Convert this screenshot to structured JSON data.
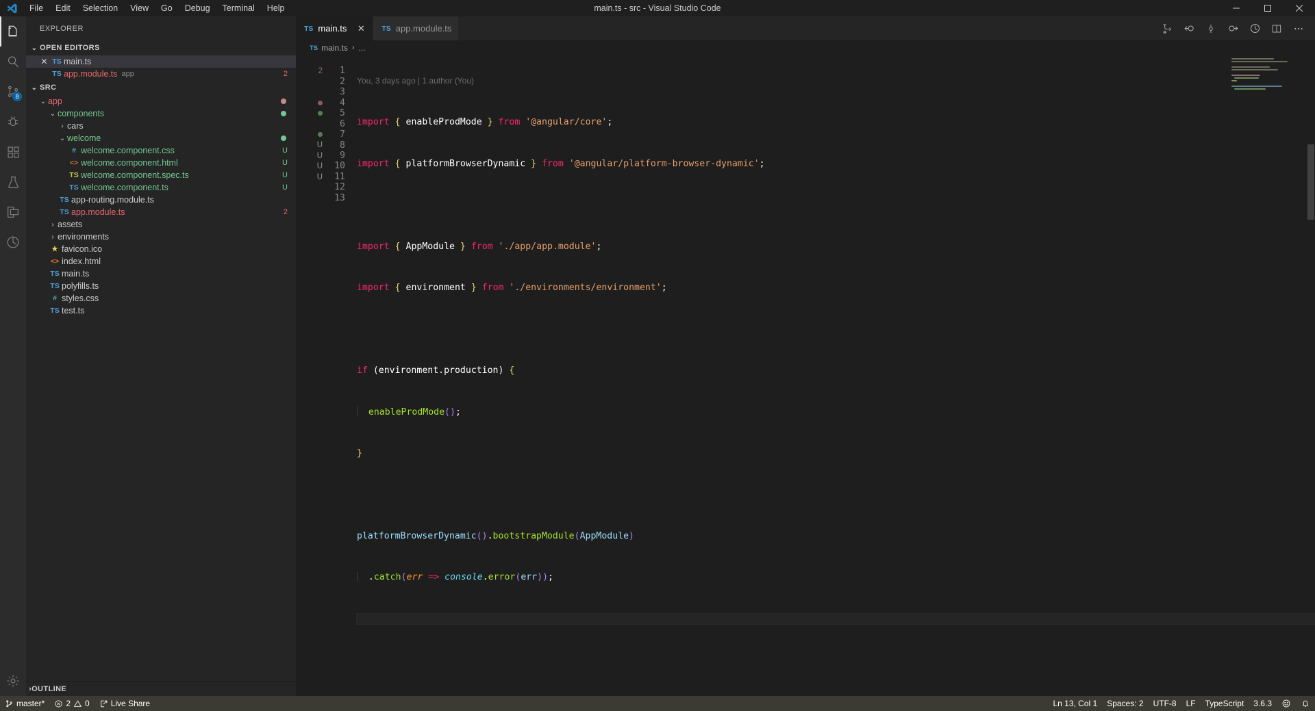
{
  "window": {
    "title": "main.ts - src - Visual Studio Code",
    "minimize_label": "─",
    "maximize_label": "□",
    "close_label": "✕"
  },
  "menubar": {
    "items": [
      {
        "label": "File"
      },
      {
        "label": "Edit"
      },
      {
        "label": "Selection"
      },
      {
        "label": "View"
      },
      {
        "label": "Go"
      },
      {
        "label": "Debug"
      },
      {
        "label": "Terminal"
      },
      {
        "label": "Help"
      }
    ]
  },
  "activitybar": {
    "items": [
      {
        "name": "explorer",
        "icon": "files-icon",
        "active": true,
        "badge": ""
      },
      {
        "name": "search",
        "icon": "search-icon",
        "active": false,
        "badge": ""
      },
      {
        "name": "source-control",
        "icon": "source-control-icon",
        "active": false,
        "badge": "8"
      },
      {
        "name": "debug",
        "icon": "debug-icon",
        "active": false,
        "badge": ""
      },
      {
        "name": "extensions",
        "icon": "extensions-icon",
        "active": false,
        "badge": ""
      },
      {
        "name": "test-explorer",
        "icon": "beaker-icon",
        "active": false,
        "badge": ""
      },
      {
        "name": "live-share",
        "icon": "live-share-icon",
        "active": false,
        "badge": ""
      },
      {
        "name": "remote",
        "icon": "remote-icon",
        "active": false,
        "badge": ""
      }
    ],
    "manage": {
      "name": "settings-gear",
      "icon": "gear-icon"
    }
  },
  "sidebar": {
    "title": "EXPLORER",
    "open_editors": {
      "header": "OPEN EDITORS",
      "expanded": true,
      "items": [
        {
          "name": "main.ts",
          "icon": "ts",
          "badge": "",
          "selected": true,
          "closable": true,
          "desc": "",
          "color": "white"
        },
        {
          "name": "app.module.ts",
          "icon": "ts",
          "badge": "2",
          "selected": false,
          "closable": false,
          "desc": "app",
          "color": "red"
        }
      ]
    },
    "src": {
      "header": "SRC",
      "expanded": true,
      "tree": [
        {
          "label": "app",
          "depth": 1,
          "type": "folder",
          "expanded": true,
          "color": "red",
          "badge": "dot-red",
          "icon": ""
        },
        {
          "label": "components",
          "depth": 2,
          "type": "folder",
          "expanded": true,
          "color": "green",
          "badge": "dot-green",
          "icon": ""
        },
        {
          "label": "cars",
          "depth": 3,
          "type": "folder",
          "expanded": false,
          "color": "white",
          "badge": "",
          "icon": ""
        },
        {
          "label": "welcome",
          "depth": 3,
          "type": "folder",
          "expanded": true,
          "color": "green",
          "badge": "dot-green",
          "icon": ""
        },
        {
          "label": "welcome.component.css",
          "depth": 4,
          "type": "file",
          "expanded": false,
          "color": "green",
          "badge": "U",
          "icon": "css"
        },
        {
          "label": "welcome.component.html",
          "depth": 4,
          "type": "file",
          "expanded": false,
          "color": "green",
          "badge": "U",
          "icon": "html"
        },
        {
          "label": "welcome.component.spec.ts",
          "depth": 4,
          "type": "file",
          "expanded": false,
          "color": "green",
          "badge": "U",
          "icon": "spec"
        },
        {
          "label": "welcome.component.ts",
          "depth": 4,
          "type": "file",
          "expanded": false,
          "color": "green",
          "badge": "U",
          "icon": "ts"
        },
        {
          "label": "app-routing.module.ts",
          "depth": 3,
          "type": "file",
          "expanded": false,
          "color": "white",
          "badge": "",
          "icon": "ts"
        },
        {
          "label": "app.module.ts",
          "depth": 3,
          "type": "file",
          "expanded": false,
          "color": "red",
          "badge": "2",
          "icon": "ts"
        },
        {
          "label": "assets",
          "depth": 2,
          "type": "folder",
          "expanded": false,
          "color": "white",
          "badge": "",
          "icon": ""
        },
        {
          "label": "environments",
          "depth": 2,
          "type": "folder",
          "expanded": false,
          "color": "white",
          "badge": "",
          "icon": ""
        },
        {
          "label": "favicon.ico",
          "depth": 2,
          "type": "file",
          "expanded": false,
          "color": "white",
          "badge": "",
          "icon": "star"
        },
        {
          "label": "index.html",
          "depth": 2,
          "type": "file",
          "expanded": false,
          "color": "white",
          "badge": "",
          "icon": "html"
        },
        {
          "label": "main.ts",
          "depth": 2,
          "type": "file",
          "expanded": false,
          "color": "white",
          "badge": "",
          "icon": "ts"
        },
        {
          "label": "polyfills.ts",
          "depth": 2,
          "type": "file",
          "expanded": false,
          "color": "white",
          "badge": "",
          "icon": "ts"
        },
        {
          "label": "styles.css",
          "depth": 2,
          "type": "file",
          "expanded": false,
          "color": "white",
          "badge": "",
          "icon": "css"
        },
        {
          "label": "test.ts",
          "depth": 2,
          "type": "file",
          "expanded": false,
          "color": "white",
          "badge": "",
          "icon": "ts"
        }
      ]
    },
    "outline": {
      "header": "OUTLINE",
      "expanded": false
    }
  },
  "editor": {
    "tabs": [
      {
        "label": "main.ts",
        "icon": "ts",
        "active": true,
        "close": "✕"
      },
      {
        "label": "app.module.ts",
        "icon": "ts",
        "active": false,
        "close": ""
      }
    ],
    "actions": [
      {
        "name": "split-merge-icon"
      },
      {
        "name": "go-back-icon"
      },
      {
        "name": "bookmark-icon"
      },
      {
        "name": "go-forward-icon"
      },
      {
        "name": "timeline-icon"
      },
      {
        "name": "split-editor-icon"
      },
      {
        "name": "more-actions-icon"
      }
    ],
    "breadcrumbs": {
      "file": "main.ts",
      "separator": "›",
      "rest": "..."
    },
    "blame": "You, 3 days ago | 1 author (You)",
    "gutter": [
      {
        "line": 1,
        "mark": "2"
      },
      {
        "line": 2,
        "mark": ""
      },
      {
        "line": 3,
        "mark": ""
      },
      {
        "line": 4,
        "mark": "dot-red"
      },
      {
        "line": 5,
        "mark": "dot-green"
      },
      {
        "line": 6,
        "mark": ""
      },
      {
        "line": 7,
        "mark": "dot-green"
      },
      {
        "line": 8,
        "mark": "U"
      },
      {
        "line": 9,
        "mark": "U"
      },
      {
        "line": 10,
        "mark": "U"
      },
      {
        "line": 11,
        "mark": "U"
      },
      {
        "line": 12,
        "mark": ""
      },
      {
        "line": 13,
        "mark": ""
      }
    ],
    "line_numbers": [
      "1",
      "2",
      "3",
      "4",
      "5",
      "6",
      "7",
      "8",
      "9",
      "10",
      "11",
      "12",
      "13"
    ],
    "code": [
      {
        "n": 1,
        "text": "import { enableProdMode } from '@angular/core';"
      },
      {
        "n": 2,
        "text": "import { platformBrowserDynamic } from '@angular/platform-browser-dynamic';"
      },
      {
        "n": 3,
        "text": ""
      },
      {
        "n": 4,
        "text": "import { AppModule } from './app/app.module';"
      },
      {
        "n": 5,
        "text": "import { environment } from './environments/environment';"
      },
      {
        "n": 6,
        "text": ""
      },
      {
        "n": 7,
        "text": "if (environment.production) {"
      },
      {
        "n": 8,
        "text": "  enableProdMode();"
      },
      {
        "n": 9,
        "text": "}"
      },
      {
        "n": 10,
        "text": ""
      },
      {
        "n": 11,
        "text": "platformBrowserDynamic().bootstrapModule(AppModule)"
      },
      {
        "n": 12,
        "text": "  .catch(err => console.error(err));"
      },
      {
        "n": 13,
        "text": ""
      }
    ]
  },
  "statusbar": {
    "left": [
      {
        "name": "branch",
        "icon": "source-control-icon",
        "label": "master*"
      },
      {
        "name": "problems",
        "icon": "error-warning",
        "label": "2 ⚠ 0",
        "errors": "2",
        "warnings": "0"
      },
      {
        "name": "live-share",
        "icon": "live-share-icon",
        "label": "Live Share"
      }
    ],
    "right": [
      {
        "name": "cursor-position",
        "label": "Ln 13, Col 1"
      },
      {
        "name": "indentation",
        "label": "Spaces: 2"
      },
      {
        "name": "encoding",
        "label": "UTF-8"
      },
      {
        "name": "eol",
        "label": "LF"
      },
      {
        "name": "language-mode",
        "label": "TypeScript"
      },
      {
        "name": "ts-version",
        "label": "3.6.3"
      },
      {
        "name": "feedback",
        "label": "☺"
      },
      {
        "name": "notifications",
        "label": "🔔"
      }
    ]
  },
  "colors": {
    "accent": "#0e639c",
    "statusbar_bg": "#3b3b33",
    "editor_bg": "#1e1e1e",
    "sidebar_bg": "#252526",
    "untracked_green": "#73c991",
    "error_red": "#e4676b"
  }
}
